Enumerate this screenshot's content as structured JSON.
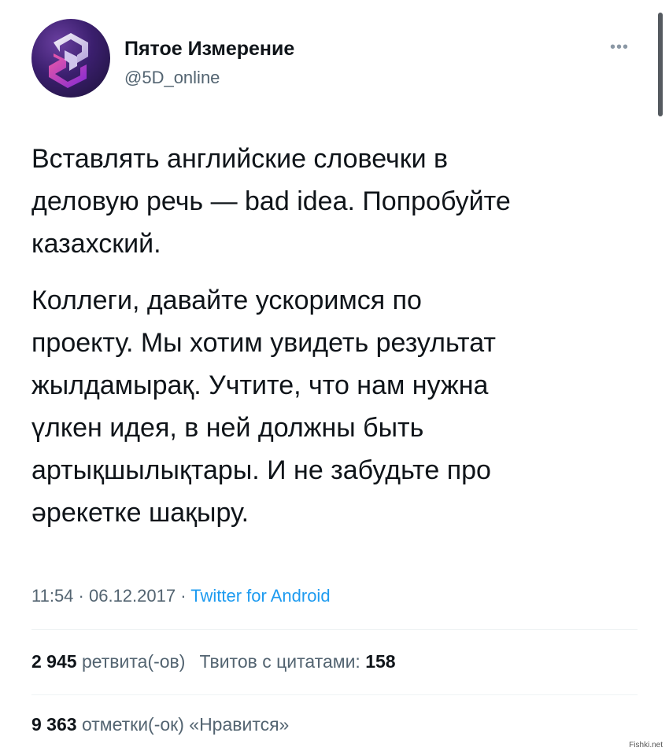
{
  "author": {
    "name": "Пятое Измерение",
    "handle": "@5D_online",
    "avatar_icon": "5d-logo-icon"
  },
  "more_icon": "more-dots-icon",
  "tweet": {
    "paragraph_1": "Вставлять английские словечки в\nделовую речь — bad idea. Попробуйте\nказахский.",
    "paragraph_2": "Коллеги, давайте ускоримся по\nпроекту. Мы хотим увидеть результат\nжылдамырақ. Учтите, что нам нужна\nүлкен идея, в ней должны быть\nартықшылықтары. И не забудьте про\nәрекетке шақыру."
  },
  "meta": {
    "time": "11:54",
    "separator": " · ",
    "date": "06.12.2017",
    "source": "Twitter for Android"
  },
  "stats": {
    "retweets_count": "2 945",
    "retweets_label": "ретвита(-ов)",
    "quotes_label": "Твитов с цитатами:",
    "quotes_count": "158",
    "likes_count": "9 363",
    "likes_label": "отметки(-ок) «Нравится»"
  },
  "watermark": "Fishki.net",
  "colors": {
    "text": "#0f1419",
    "secondary": "#536471",
    "link": "#1d9bf0",
    "divider": "#eff3f4"
  }
}
